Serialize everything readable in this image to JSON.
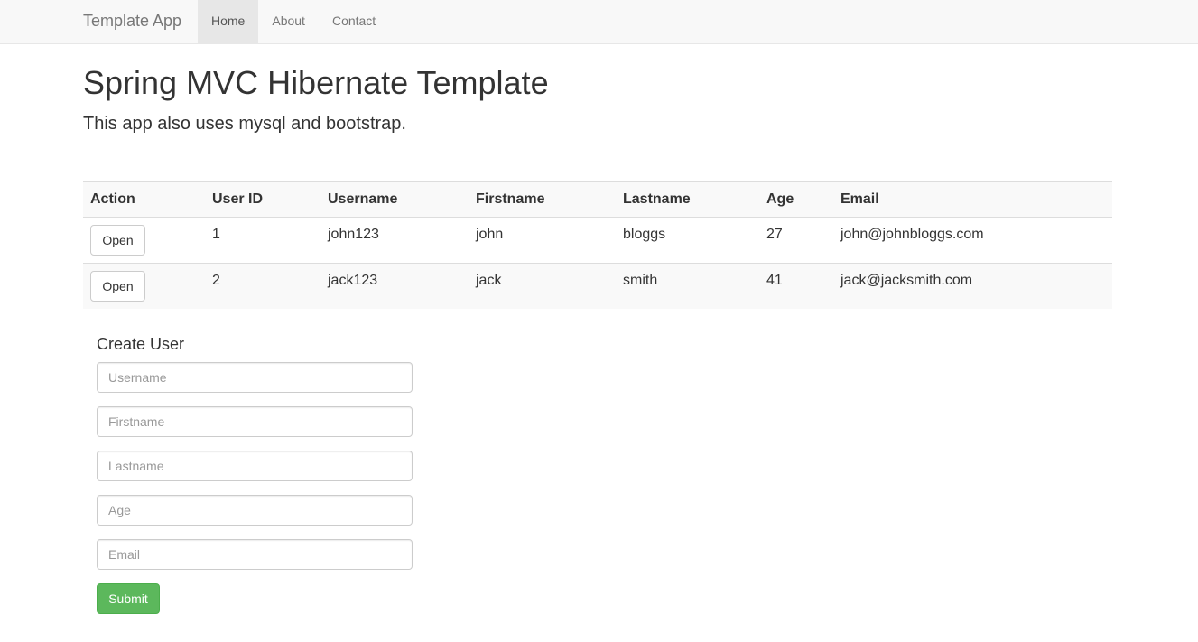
{
  "navbar": {
    "brand": "Template App",
    "items": [
      {
        "label": "Home",
        "active": true
      },
      {
        "label": "About",
        "active": false
      },
      {
        "label": "Contact",
        "active": false
      }
    ]
  },
  "header": {
    "title": "Spring MVC Hibernate Template",
    "lead": "This app also uses mysql and bootstrap."
  },
  "table": {
    "columns": [
      "Action",
      "User ID",
      "Username",
      "Firstname",
      "Lastname",
      "Age",
      "Email"
    ],
    "rows": [
      {
        "action": "Open",
        "id": "1",
        "username": "john123",
        "firstname": "john",
        "lastname": "bloggs",
        "age": "27",
        "email": "john@johnbloggs.com"
      },
      {
        "action": "Open",
        "id": "2",
        "username": "jack123",
        "firstname": "jack",
        "lastname": "smith",
        "age": "41",
        "email": "jack@jacksmith.com"
      }
    ]
  },
  "form": {
    "title": "Create User",
    "fields": {
      "username": {
        "placeholder": "Username",
        "value": ""
      },
      "firstname": {
        "placeholder": "Firstname",
        "value": ""
      },
      "lastname": {
        "placeholder": "Lastname",
        "value": ""
      },
      "age": {
        "placeholder": "Age",
        "value": ""
      },
      "email": {
        "placeholder": "Email",
        "value": ""
      }
    },
    "submit_label": "Submit"
  },
  "colors": {
    "navbar_bg": "#f8f8f8",
    "nav_active_bg": "#e7e7e7",
    "submit_green": "#5cb85c",
    "text": "#333333"
  }
}
